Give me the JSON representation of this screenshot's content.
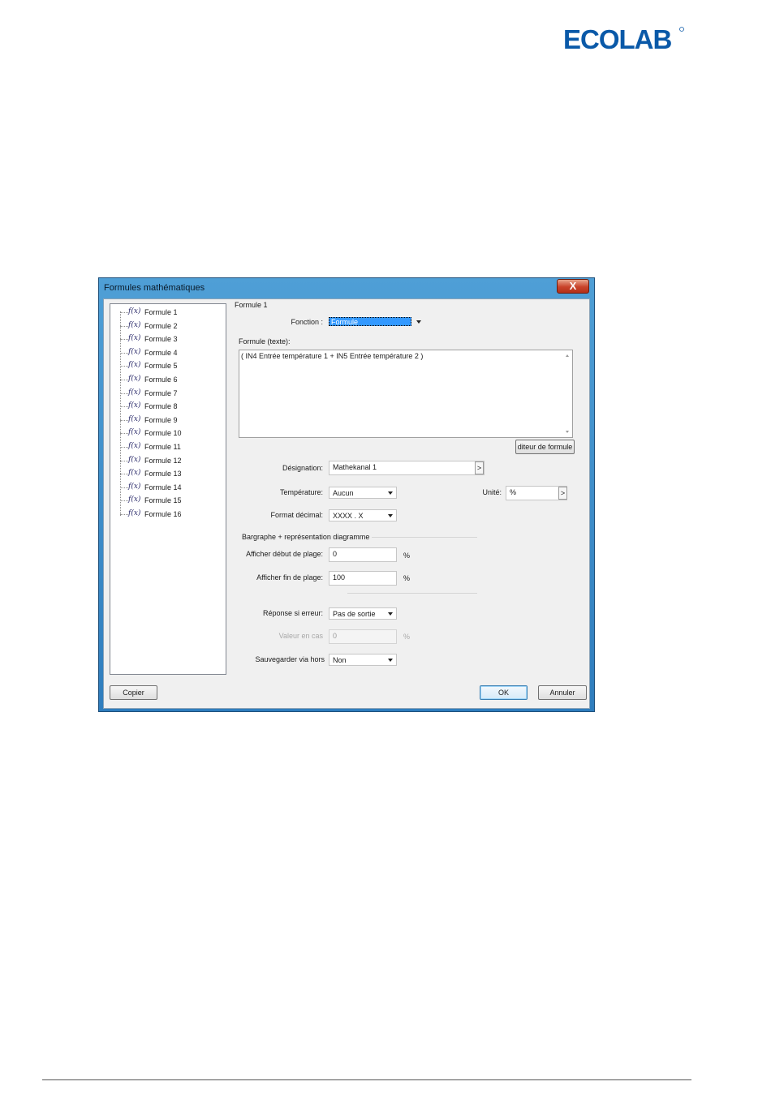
{
  "brand": {
    "logo_text": "ECOLAB"
  },
  "dialog": {
    "title": "Formules mathématiques",
    "close_label": "X",
    "tree": {
      "fx_symbol": "f(x)",
      "items": [
        "Formule 1",
        "Formule 2",
        "Formule 3",
        "Formule 4",
        "Formule 5",
        "Formule 6",
        "Formule 7",
        "Formule 8",
        "Formule 9",
        "Formule 10",
        "Formule 11",
        "Formule 12",
        "Formule 13",
        "Formule 14",
        "Formule 15",
        "Formule 16"
      ]
    },
    "section_title": "Formule 1",
    "fonction": {
      "label": "Fonction :",
      "value": "Formule"
    },
    "formula_text": {
      "label": "Formule (texte):",
      "value": "( IN4 Entrée température  1 + IN5 Entrée température  2 )"
    },
    "editor_button": "diteur de formule",
    "designation": {
      "label": "Désignation:",
      "value": "Mathekanal 1",
      "button": ">"
    },
    "temperature": {
      "label": "Température:",
      "value": "Aucun"
    },
    "unite": {
      "label": "Unité:",
      "value": "%",
      "button": ">"
    },
    "format_decimal": {
      "label": "Format décimal:",
      "value": "XXXX . X"
    },
    "bargraph_section": "Bargraphe + représentation diagramme",
    "afficher_debut": {
      "label": "Afficher début de plage:",
      "value": "0",
      "unit": "%"
    },
    "afficher_fin": {
      "label": "Afficher fin de plage:",
      "value": "100",
      "unit": "%"
    },
    "reponse_erreur": {
      "label": "Réponse si erreur:",
      "value": "Pas de sortie"
    },
    "valeur_cas": {
      "label": "Valeur en cas",
      "value": "0",
      "unit": "%"
    },
    "sauvegarder": {
      "label": "Sauvegarder via hors",
      "value": "Non"
    },
    "buttons": {
      "copier": "Copier",
      "ok": "OK",
      "annuler": "Annuler"
    }
  },
  "colors": {
    "titlebar": "#3a8ccb",
    "selection": "#3399ff",
    "brand_blue": "#0a59a8"
  }
}
